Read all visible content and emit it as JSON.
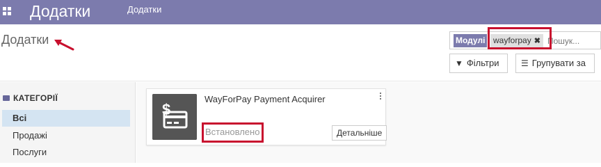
{
  "navbar": {
    "brand": "Додатки",
    "menu_item": "Додатки"
  },
  "control_panel": {
    "title": "Додатки",
    "search": {
      "facet_label": "Модулі",
      "facet_value": "wayforpay",
      "facet_close": "✖",
      "placeholder": "Пошук..."
    },
    "filters_label": "Фільтри",
    "group_by_label": "Групувати за"
  },
  "sidebar": {
    "header": "КАТЕГОРІЇ",
    "items": [
      {
        "label": "Всі",
        "active": true
      },
      {
        "label": "Продажі",
        "active": false
      },
      {
        "label": "Послуги",
        "active": false
      }
    ]
  },
  "module_card": {
    "title": "WayForPay Payment Acquirer",
    "status": "Встановлено",
    "details_label": "Детальніше"
  },
  "colors": {
    "navbar": "#7c7bad",
    "annotation": "#c8102e"
  }
}
